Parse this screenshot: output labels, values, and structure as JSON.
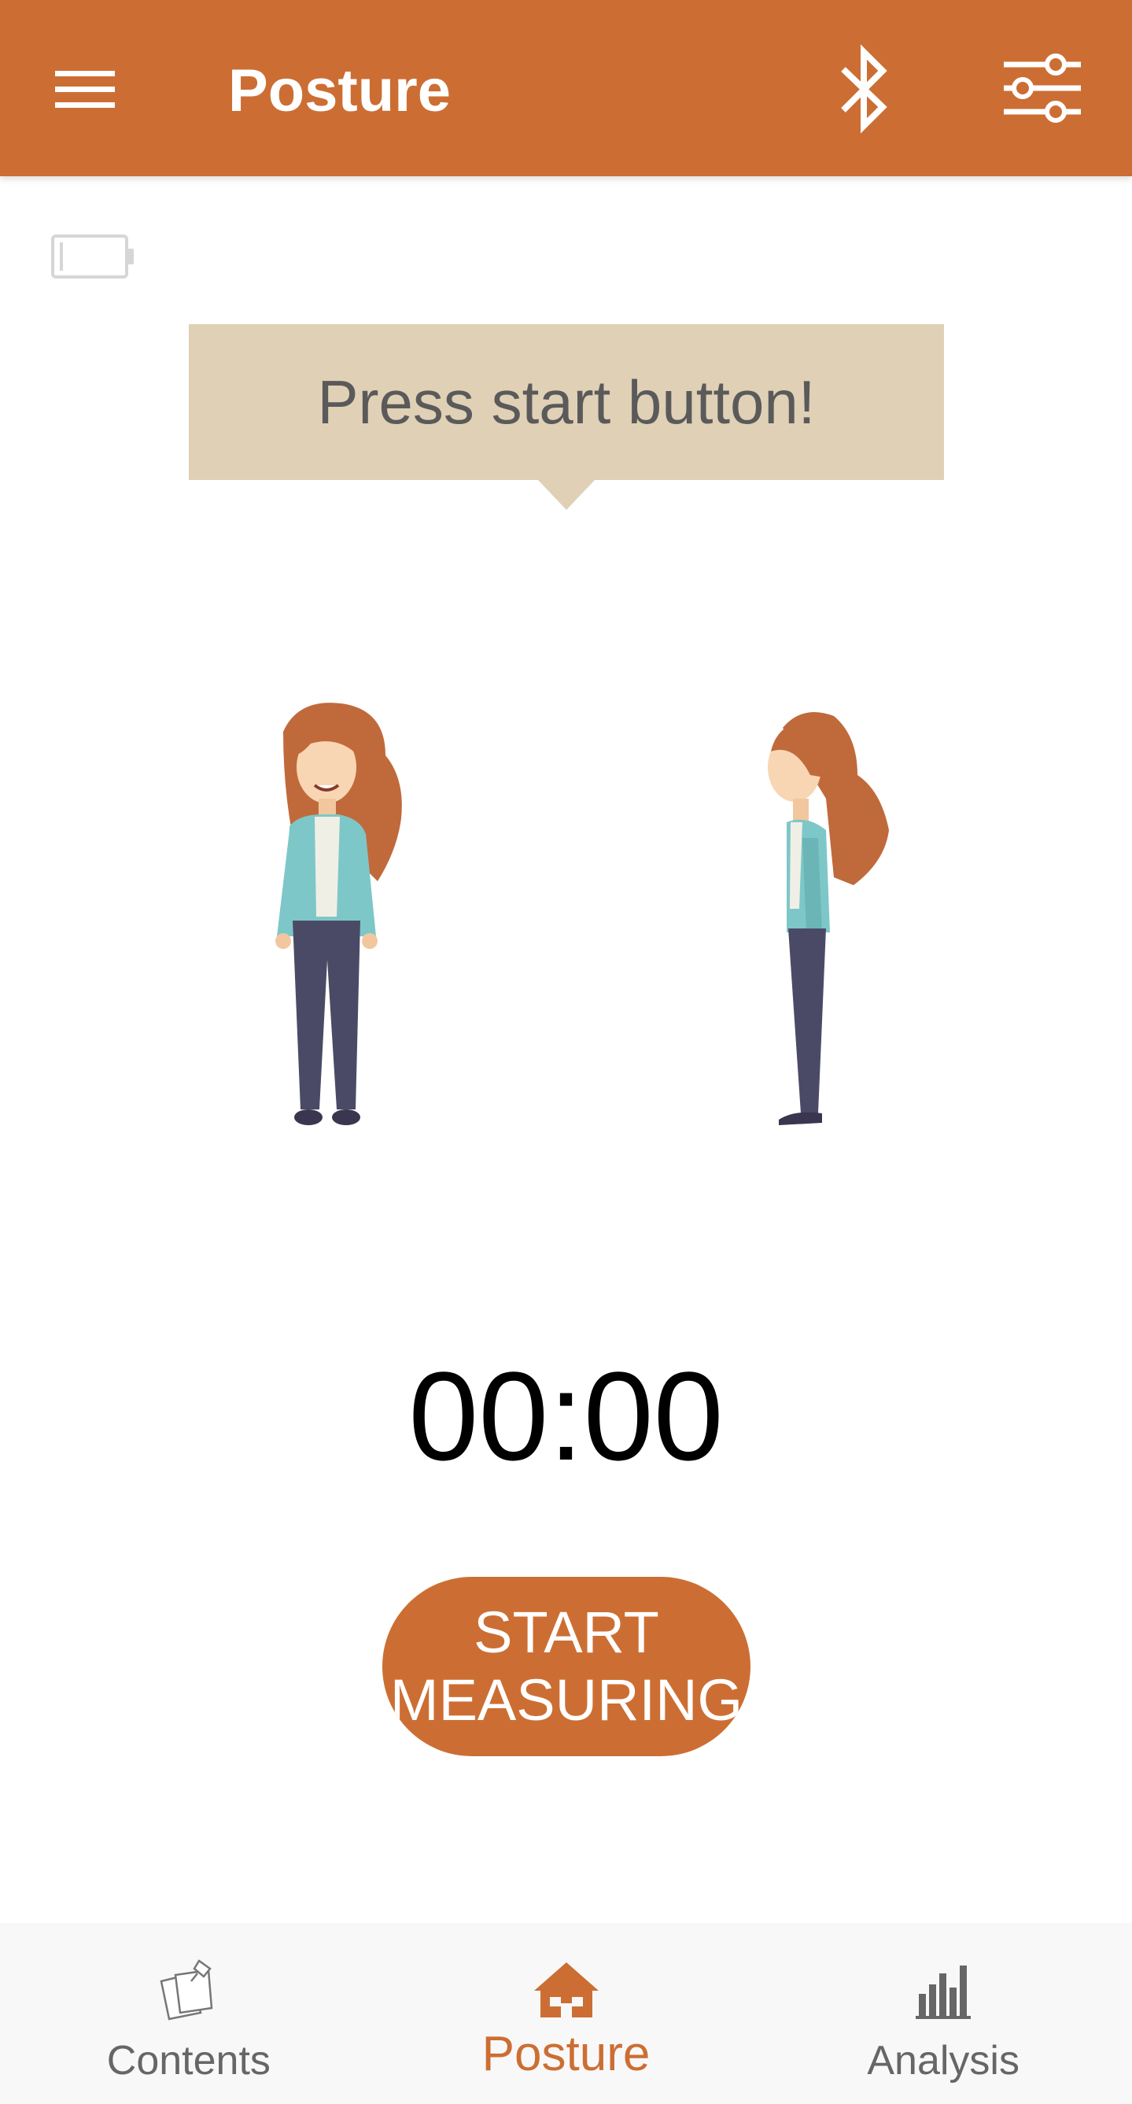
{
  "app_bar": {
    "title": "Posture",
    "menu_icon": "hamburger-menu-icon",
    "bluetooth_icon": "bluetooth-icon",
    "settings_icon": "sliders-settings-icon"
  },
  "status": {
    "battery_icon": "battery-empty-icon"
  },
  "speech_bubble": {
    "text": "Press start button!"
  },
  "illustrations": {
    "front": "woman-front-view-illustration",
    "side": "woman-side-view-illustration"
  },
  "timer": {
    "value": "00:00"
  },
  "start_button": {
    "line1": "START",
    "line2": "MEASURING"
  },
  "bottom_nav": {
    "items": [
      {
        "label": "Contents",
        "icon": "notes-pin-icon",
        "active": false
      },
      {
        "label": "Posture",
        "icon": "home-icon",
        "active": true
      },
      {
        "label": "Analysis",
        "icon": "bar-chart-icon",
        "active": false
      }
    ]
  },
  "colors": {
    "accent": "#cc6e33",
    "bubble": "#e0d0b6",
    "nav_bg": "#f8f8f8"
  }
}
